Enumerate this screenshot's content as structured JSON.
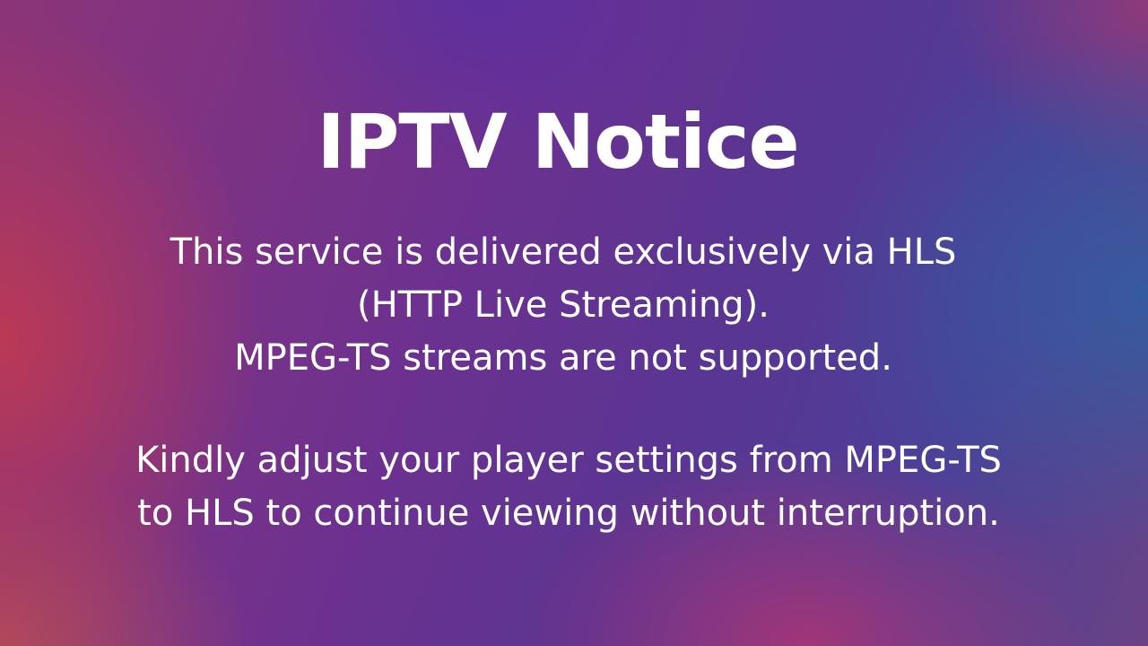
{
  "notice": {
    "title": "IPTV Notice",
    "paragraph_1": [
      "This service is delivered exclusively via HLS",
      "(HTTP Live Streaming).",
      "MPEG-TS streams are not supported."
    ],
    "paragraph_2": [
      "Kindly adjust your player settings from MPEG-TS",
      "to HLS to continue viewing without interruption."
    ]
  },
  "colors": {
    "text": "#ffffff",
    "background_left": "#b03a5e",
    "background_center": "#6c3190",
    "background_right": "#3a559c"
  }
}
